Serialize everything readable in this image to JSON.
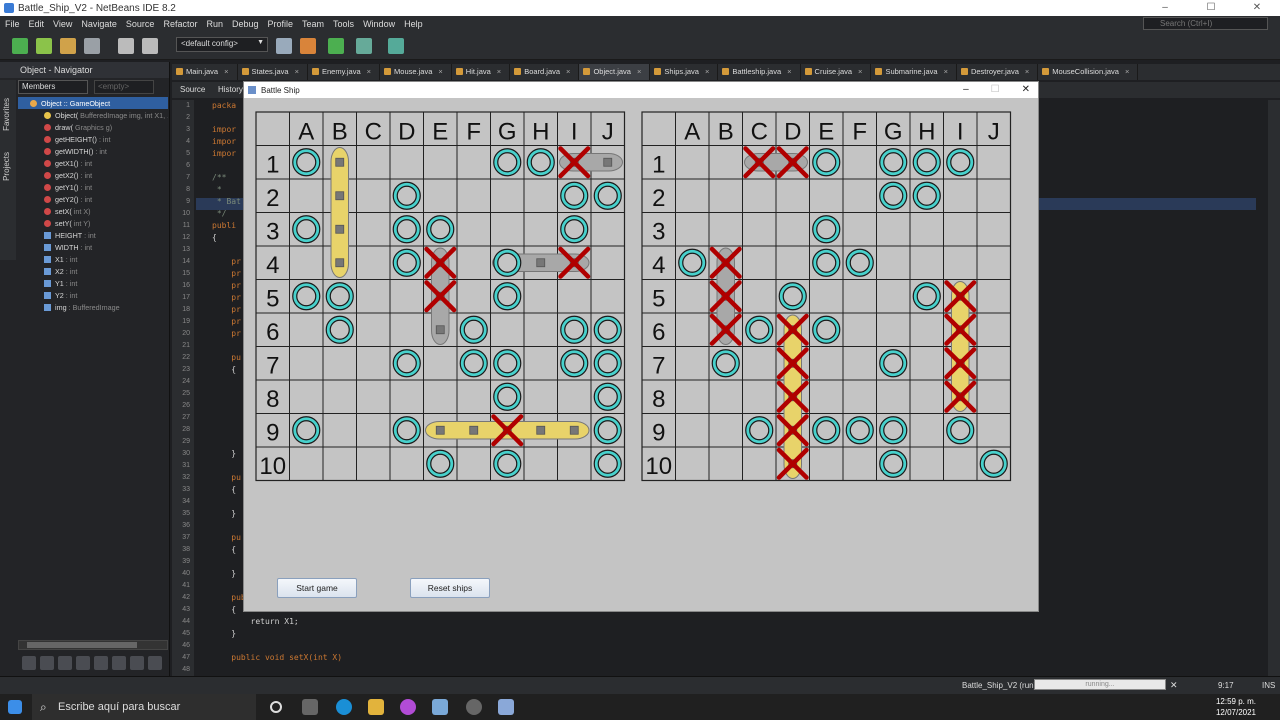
{
  "window": {
    "title": "Battle_Ship_V2 - NetBeans IDE 8.2",
    "controls": [
      "–",
      "☐",
      "✕"
    ]
  },
  "menu": [
    "File",
    "Edit",
    "View",
    "Navigate",
    "Source",
    "Refactor",
    "Run",
    "Debug",
    "Profile",
    "Team",
    "Tools",
    "Window",
    "Help"
  ],
  "search_placeholder": "Search (Ctrl+I)",
  "toolbar": {
    "config": "<default config>"
  },
  "navigator": {
    "title": "Object - Navigator",
    "filter": "Members",
    "filter2": "<empty>",
    "side_tabs": [
      "Favorites",
      "Projects"
    ],
    "items": [
      {
        "label": "Object :: GameObject",
        "sig": "",
        "kind": "class"
      },
      {
        "label": "Object(",
        "sig": "BufferedImage img, int X1, ...",
        "kind": "ctor"
      },
      {
        "label": "draw(",
        "sig": "Graphics g)",
        "kind": "method"
      },
      {
        "label": "getHEIGHT()",
        "sig": ": int",
        "kind": "method"
      },
      {
        "label": "getWIDTH()",
        "sig": ": int",
        "kind": "method"
      },
      {
        "label": "getX1()",
        "sig": ": int",
        "kind": "method"
      },
      {
        "label": "getX2()",
        "sig": ": int",
        "kind": "method"
      },
      {
        "label": "getY1()",
        "sig": ": int",
        "kind": "method"
      },
      {
        "label": "getY2()",
        "sig": ": int",
        "kind": "method"
      },
      {
        "label": "setX(",
        "sig": "int X)",
        "kind": "method"
      },
      {
        "label": "setY(",
        "sig": "int Y)",
        "kind": "method"
      },
      {
        "label": "HEIGHT",
        "sig": ": int",
        "kind": "field"
      },
      {
        "label": "WIDTH",
        "sig": ": int",
        "kind": "field"
      },
      {
        "label": "X1",
        "sig": ": int",
        "kind": "field"
      },
      {
        "label": "X2",
        "sig": ": int",
        "kind": "field"
      },
      {
        "label": "Y1",
        "sig": ": int",
        "kind": "field"
      },
      {
        "label": "Y2",
        "sig": ": int",
        "kind": "field"
      },
      {
        "label": "img",
        "sig": ": BufferedImage",
        "kind": "field"
      }
    ]
  },
  "tabs": [
    "Main.java",
    "States.java",
    "Enemy.java",
    "Mouse.java",
    "Hit.java",
    "Board.java",
    "Object.java",
    "Ships.java",
    "Battleship.java",
    "Cruise.java",
    "Submarine.java",
    "Destroyer.java",
    "MouseCollision.java"
  ],
  "active_tab": "Object.java",
  "editor": {
    "source_tab": "Source",
    "history_tab": "History",
    "line_numbers": [
      "1",
      "2",
      "3",
      "4",
      "5",
      "6",
      "7",
      "8",
      "9",
      "10",
      "11",
      "12",
      "13",
      "14",
      "15",
      "16",
      "17",
      "18",
      "19",
      "20",
      "21",
      "22",
      "23",
      "24",
      "25",
      "26",
      "27",
      "28",
      "29",
      "30",
      "31",
      "32",
      "33",
      "34",
      "35",
      "36",
      "37",
      "38",
      "39",
      "40",
      "41",
      "42",
      "43",
      "44",
      "45",
      "46",
      "47",
      "48"
    ],
    "visible_code": [
      {
        "line": 1,
        "text": "packa"
      },
      {
        "line": 3,
        "text": "impor"
      },
      {
        "line": 4,
        "text": "impor"
      },
      {
        "line": 5,
        "text": "impor"
      },
      {
        "line": 7,
        "text": "/**"
      },
      {
        "line": 8,
        "text": " *"
      },
      {
        "line": 9,
        "text": " * Bat"
      },
      {
        "line": 10,
        "text": " */"
      },
      {
        "line": 11,
        "text": "publi"
      },
      {
        "line": 12,
        "text": "{"
      },
      {
        "line": 14,
        "text": "    pr"
      },
      {
        "line": 15,
        "text": "    pr"
      },
      {
        "line": 16,
        "text": "    pr"
      },
      {
        "line": 17,
        "text": "    pr"
      },
      {
        "line": 18,
        "text": "    pr"
      },
      {
        "line": 19,
        "text": "    pr"
      },
      {
        "line": 20,
        "text": "    pr"
      },
      {
        "line": 22,
        "text": "    pu"
      },
      {
        "line": 23,
        "text": "    {"
      },
      {
        "line": 30,
        "text": "    }"
      },
      {
        "line": 32,
        "text": "    pu"
      },
      {
        "line": 33,
        "text": "    {"
      },
      {
        "line": 35,
        "text": "    }"
      },
      {
        "line": 37,
        "text": "    pu"
      },
      {
        "line": 38,
        "text": "    {"
      },
      {
        "line": 40,
        "text": "    }"
      },
      {
        "line": 42,
        "text": "    public int getX1()"
      },
      {
        "line": 43,
        "text": "    {"
      },
      {
        "line": 44,
        "text": "        return X1;"
      },
      {
        "line": 45,
        "text": "    }"
      },
      {
        "line": 47,
        "text": "    public void setX(int X)"
      }
    ]
  },
  "game": {
    "title": "Battle Ship",
    "columns": [
      "A",
      "B",
      "C",
      "D",
      "E",
      "F",
      "G",
      "H",
      "I",
      "J"
    ],
    "rows": [
      "1",
      "2",
      "3",
      "4",
      "5",
      "6",
      "7",
      "8",
      "9",
      "10"
    ],
    "left_board": {
      "misses": [
        "A1",
        "G1",
        "H1",
        "D2",
        "I2",
        "J2",
        "A3",
        "D3",
        "E3",
        "I3",
        "D4",
        "G4",
        "A5",
        "B5",
        "G5",
        "B6",
        "F6",
        "I6",
        "J6",
        "D7",
        "F7",
        "G7",
        "I7",
        "J7",
        "G8",
        "J8",
        "A9",
        "D9",
        "J9",
        "E10",
        "G10",
        "J10"
      ],
      "hits": [
        "I1",
        "E4",
        "I4",
        "E5",
        "G9"
      ],
      "ships": [
        {
          "color": "yellow",
          "orientation": "vertical",
          "start": "B1",
          "length": 4
        },
        {
          "color": "gray",
          "orientation": "horizontal",
          "start": "I1",
          "length": 2
        },
        {
          "color": "gray",
          "orientation": "horizontal",
          "start": "G4",
          "length": 3
        },
        {
          "color": "gray",
          "orientation": "vertical",
          "start": "E4",
          "length": 3
        },
        {
          "color": "yellow",
          "orientation": "horizontal",
          "start": "E9",
          "length": 5
        }
      ]
    },
    "right_board": {
      "misses": [
        "E1",
        "G1",
        "H1",
        "I1",
        "G2",
        "H2",
        "E3",
        "A4",
        "E4",
        "F4",
        "D5",
        "H5",
        "C6",
        "E6",
        "B7",
        "G7",
        "C9",
        "E9",
        "F9",
        "G9",
        "I9",
        "G10",
        "J10"
      ],
      "hits": [
        "C1",
        "D1",
        "B4",
        "B5",
        "I5",
        "B6",
        "D6",
        "I6",
        "D7",
        "I7",
        "D8",
        "I8",
        "D9",
        "D10"
      ],
      "ships": [
        {
          "color": "gray",
          "orientation": "horizontal",
          "start": "C1",
          "length": 2
        },
        {
          "color": "gray",
          "orientation": "vertical",
          "start": "B4",
          "length": 3
        },
        {
          "color": "yellow",
          "orientation": "vertical",
          "start": "D6",
          "length": 5
        },
        {
          "color": "yellow",
          "orientation": "vertical",
          "start": "I5",
          "length": 4
        }
      ]
    },
    "buttons": {
      "start": "Start game",
      "reset": "Reset ships"
    }
  },
  "status": {
    "project": "Battle_Ship_V2 (run)",
    "progress": "running...",
    "position": "9:17",
    "mode": "INS"
  },
  "taskbar": {
    "search": "Escribe aquí para buscar",
    "time": "12:59 p. m.",
    "date": "12/07/2021"
  },
  "colors": {
    "miss": "#48d1cc",
    "hit": "#b00000",
    "yellow_ship": "#e8d36a",
    "gray_ship": "#a8a8a8",
    "board_bg": "#c4c4c4"
  }
}
